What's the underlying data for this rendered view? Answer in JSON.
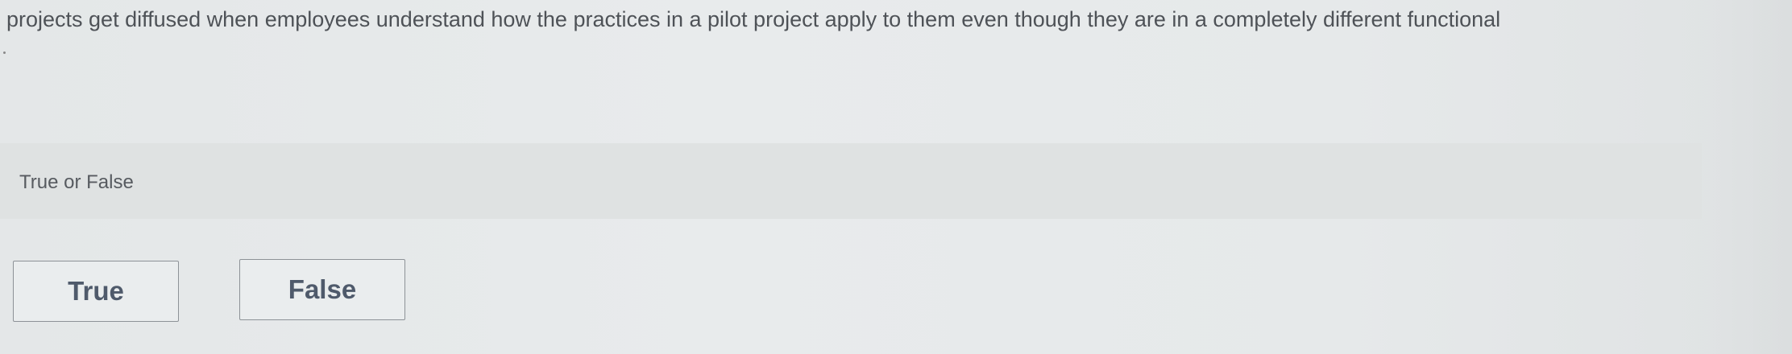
{
  "question": {
    "text": "projects get diffused when employees understand how the practices in a pilot project apply to them even though they are in a completely different functional"
  },
  "prompt": {
    "label": "True or False"
  },
  "answers": {
    "true_label": "True",
    "false_label": "False"
  },
  "colors": {
    "text": "#4e5257",
    "button_text": "#4f5a6b",
    "button_border": "#8d9297",
    "band": "#dfe2e2"
  }
}
